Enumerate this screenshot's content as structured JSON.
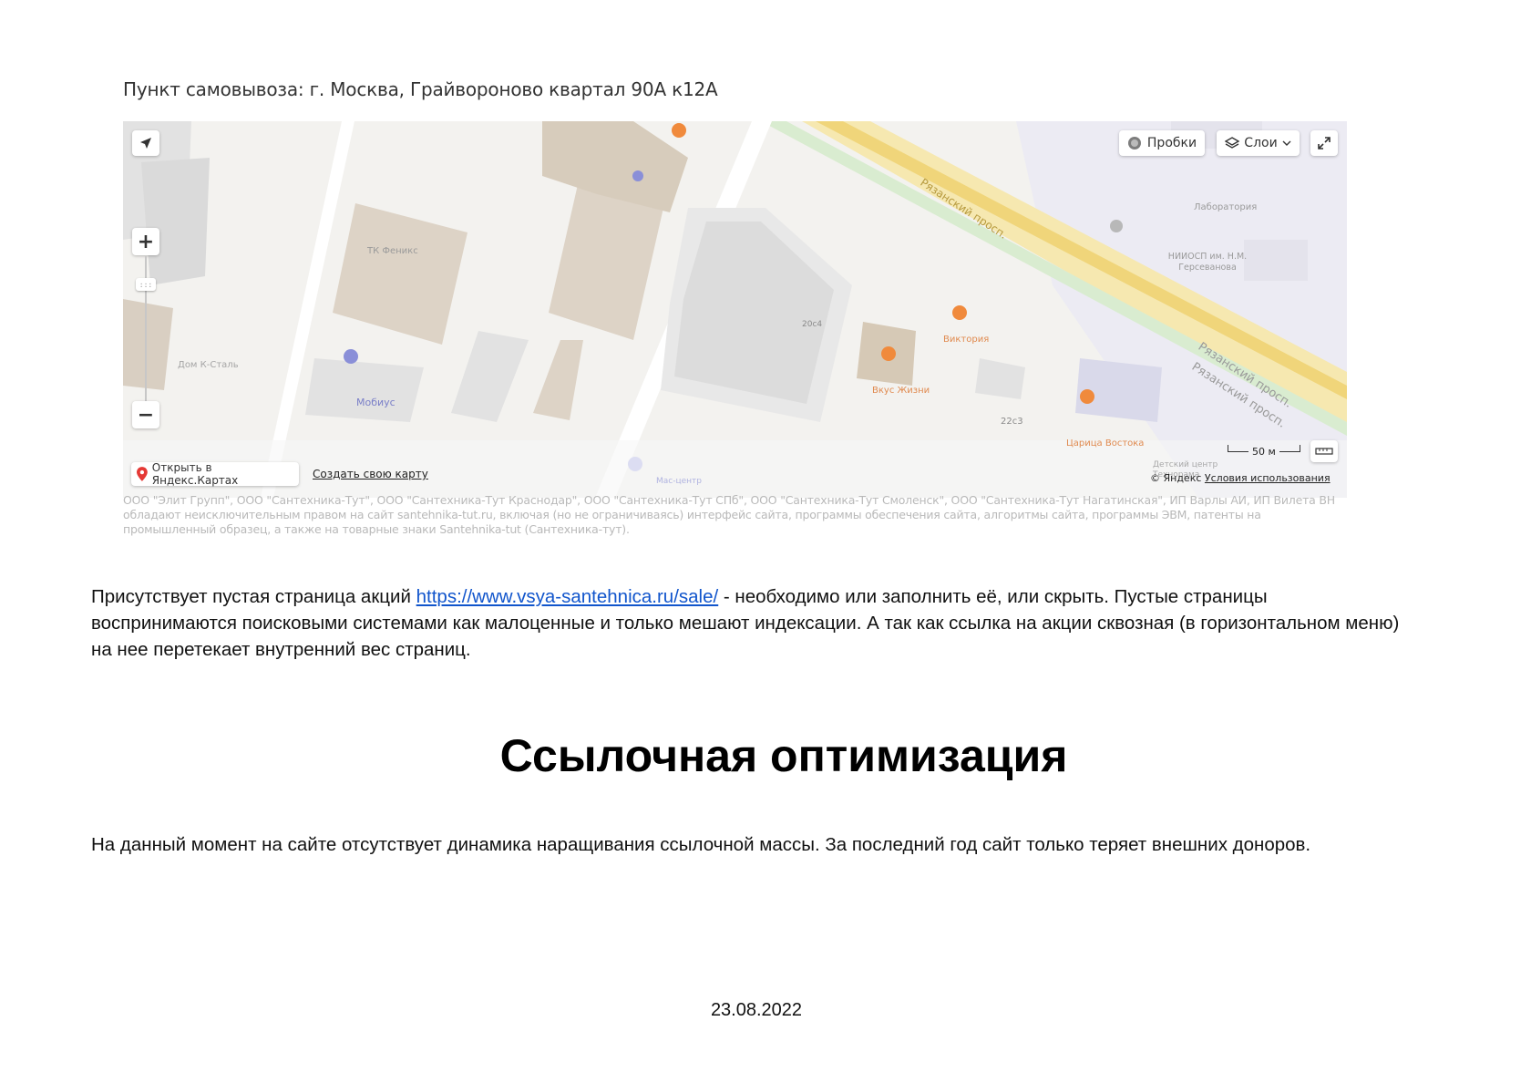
{
  "screenshot": {
    "caption": "Пункт самовывоза: г. Москва, Грайвороново квартал 90А к12А",
    "map": {
      "controls": {
        "traffic_label": "Пробки",
        "layers_label": "Слои",
        "zoom_in": "+",
        "zoom_out": "−",
        "open_in_yandex": "Открыть в Яндекс.Картах",
        "create_map": "Создать свою карту",
        "scale": "50 м",
        "copyright": "© Яндекс",
        "terms": "Условия использования"
      },
      "labels": {
        "phoenix": "ТК Феникс",
        "mobius": "Мобиус",
        "dom_k_stal": "Дом К-Сталь",
        "victoria": "Виктория",
        "vkus_zhizni": "Вкус Жизни",
        "tsaritsa_vostoka": "Царица Востока",
        "laboratoriya": "Лаборатория",
        "niiosp": "НИИОСП им. Н.М. Герсеванова",
        "ryazansky_1": "Рязанский просп.",
        "ryazansky_2": "Рязанский просп.",
        "ryazansky_3": "Рязанский просп.",
        "building_20s4": "20с4",
        "building_22s3": "22с3",
        "mas_center": "Мас-центр",
        "detsky": "Детский центр Технорама"
      },
      "colors": {
        "ground": "#f3f2ef",
        "building": "#ddd3c6",
        "building_dark": "#cfc3b3",
        "road": "#ffffff",
        "highway": "#f4e3a1",
        "green_lane": "#cfe8c4",
        "block_gray": "#e4e4e4",
        "poi_orange": "#f08a3c",
        "poi_purple": "#8a8fd8"
      }
    },
    "legal_text": "ООО \"Элит Групп\", ООО \"Сантехника-Тут\", ООО \"Сантехника-Тут Краснодар\", ООО \"Сантехника-Тут СПб\", ООО \"Сантехника-Тут Смоленск\", ООО \"Сантехника-Тут Нагатинская\", ИП Варлы АИ, ИП Вилета ВН обладают неисключительным правом на сайт santehnika-tut.ru, включая (но не ограничиваясь) интерфейс сайта, программы обеспечения сайта, алгоритмы сайта, программы ЭВМ, патенты на промышленный образец, а также на товарные знаки Santehnika-tut (Сантехника-тут)."
  },
  "paragraph1": {
    "before_link": "Присутствует пустая страница акций ",
    "link": "https://www.vsya-santehnica.ru/sale/",
    "after_link": " - необходимо или заполнить её, или скрыть. Пустые страницы воспринимаются поисковыми системами как малоценные и только мешают индексации. А так как ссылка на акции сквозная (в горизонтальном меню) на нее перетекает внутренний вес страниц."
  },
  "heading": "Ссылочная оптимизация",
  "paragraph2": "На данный момент на сайте отсутствует динамика наращивания ссылочной массы. За последний год сайт только теряет внешних доноров.",
  "footer_date": "23.08.2022"
}
